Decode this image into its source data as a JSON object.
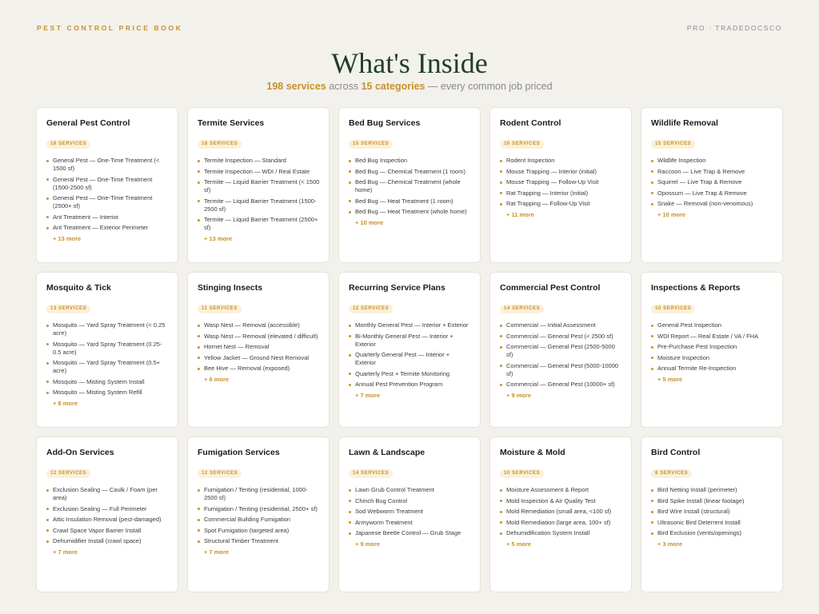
{
  "header": {
    "brand": "PEST CONTROL PRICE BOOK",
    "tag": "PRO · TRADEDOCSCO"
  },
  "hero": {
    "title": "What's Inside",
    "services_count": "198 services",
    "across": " across ",
    "categories_count": "15 categories",
    "tail": " — every common job priced"
  },
  "cards": [
    {
      "title": "General Pest Control",
      "badge": "18 SERVICES",
      "items": [
        "General Pest — One-Time Treatment (< 1500 sf)",
        "General Pest — One-Time Treatment (1500-2500 sf)",
        "General Pest — One-Time Treatment (2500+ sf)",
        "Ant Treatment — Interior",
        "Ant Treatment — Exterior Perimeter"
      ],
      "more": "+ 13 more"
    },
    {
      "title": "Termite Services",
      "badge": "18 SERVICES",
      "items": [
        "Termite Inspection — Standard",
        "Termite Inspection — WDI / Real Estate",
        "Termite — Liquid Barrier Treatment (< 1500 sf)",
        "Termite — Liquid Barrier Treatment (1500-2500 sf)",
        "Termite — Liquid Barrier Treatment (2500+ sf)"
      ],
      "more": "+ 13 more"
    },
    {
      "title": "Bed Bug Services",
      "badge": "15 SERVICES",
      "items": [
        "Bed Bug Inspection",
        "Bed Bug — Chemical Treatment (1 room)",
        "Bed Bug — Chemical Treatment (whole home)",
        "Bed Bug — Heat Treatment (1 room)",
        "Bed Bug — Heat Treatment (whole home)"
      ],
      "more": "+ 10 more"
    },
    {
      "title": "Rodent Control",
      "badge": "16 SERVICES",
      "items": [
        "Rodent Inspection",
        "Mouse Trapping — Interior (initial)",
        "Mouse Trapping — Follow-Up Visit",
        "Rat Trapping — Interior (initial)",
        "Rat Trapping — Follow-Up Visit"
      ],
      "more": "+ 11 more"
    },
    {
      "title": "Wildlife Removal",
      "badge": "15 SERVICES",
      "items": [
        "Wildlife Inspection",
        "Raccoon — Live Trap & Remove",
        "Squirrel — Live Trap & Remove",
        "Opossum — Live Trap & Remove",
        "Snake — Removal (non-venomous)"
      ],
      "more": "+ 10 more"
    },
    {
      "title": "Mosquito & Tick",
      "badge": "13 SERVICES",
      "items": [
        "Mosquito — Yard Spray Treatment (< 0.25 acre)",
        "Mosquito — Yard Spray Treatment (0.25-0.5 acre)",
        "Mosquito — Yard Spray Treatment (0.5+ acre)",
        "Mosquito — Misting System Install",
        "Mosquito — Misting System Refill"
      ],
      "more": "+ 8 more"
    },
    {
      "title": "Stinging Insects",
      "badge": "11 SERVICES",
      "items": [
        "Wasp Nest — Removal (accessible)",
        "Wasp Nest — Removal (elevated / difficult)",
        "Hornet Nest — Removal",
        "Yellow Jacket — Ground Nest Removal",
        "Bee Hive — Removal (exposed)"
      ],
      "more": "+ 6 more"
    },
    {
      "title": "Recurring Service Plans",
      "badge": "12 SERVICES",
      "items": [
        "Monthly General Pest — Interior + Exterior",
        "Bi-Monthly General Pest — Interior + Exterior",
        "Quarterly General Pest — Interior + Exterior",
        "Quarterly Pest + Termite Monitoring",
        "Annual Pest Prevention Program"
      ],
      "more": "+ 7 more"
    },
    {
      "title": "Commercial Pest Control",
      "badge": "14 SERVICES",
      "items": [
        "Commercial — Initial Assessment",
        "Commercial — General Pest (< 2500 sf)",
        "Commercial — General Pest (2500-5000 sf)",
        "Commercial — General Pest (5000-10000 sf)",
        "Commercial — General Pest (10000+ sf)"
      ],
      "more": "+ 9 more"
    },
    {
      "title": "Inspections & Reports",
      "badge": "10 SERVICES",
      "items": [
        "General Pest Inspection",
        "WDI Report — Real Estate / VA / FHA",
        "Pre-Purchase Pest Inspection",
        "Moisture Inspection",
        "Annual Termite Re-Inspection"
      ],
      "more": "+ 5 more"
    },
    {
      "title": "Add-On Services",
      "badge": "12 SERVICES",
      "items": [
        "Exclusion Sealing — Caulk / Foam (per area)",
        "Exclusion Sealing — Full Perimeter",
        "Attic Insulation Removal (pest-damaged)",
        "Crawl Space Vapor Barrier Install",
        "Dehumidifier Install (crawl space)"
      ],
      "more": "+ 7 more"
    },
    {
      "title": "Fumigation Services",
      "badge": "12 SERVICES",
      "items": [
        "Fumigation / Tenting (residential, 1000-2500 sf)",
        "Fumigation / Tenting (residential, 2500+ sf)",
        "Commercial Building Fumigation",
        "Spot Fumigation (targeted area)",
        "Structural Timber Treatment"
      ],
      "more": "+ 7 more"
    },
    {
      "title": "Lawn & Landscape",
      "badge": "14 SERVICES",
      "items": [
        "Lawn Grub Control Treatment",
        "Chinch Bug Control",
        "Sod Webworm Treatment",
        "Armyworm Treatment",
        "Japanese Beetle Control — Grub Stage"
      ],
      "more": "+ 9 more"
    },
    {
      "title": "Moisture & Mold",
      "badge": "10 SERVICES",
      "items": [
        "Moisture Assessment & Report",
        "Mold Inspection & Air Quality Test",
        "Mold Remediation (small area, <100 sf)",
        "Mold Remediation (large area, 100+ sf)",
        "Dehumidification System Install"
      ],
      "more": "+ 5 more"
    },
    {
      "title": "Bird Control",
      "badge": "8 SERVICES",
      "items": [
        "Bird Netting Install (perimeter)",
        "Bird Spike Install (linear footage)",
        "Bird Wire Install (structural)",
        "Ultrasonic Bird Deterrent Install",
        "Bird Exclusion (vents/openings)"
      ],
      "more": "+ 3 more"
    }
  ]
}
